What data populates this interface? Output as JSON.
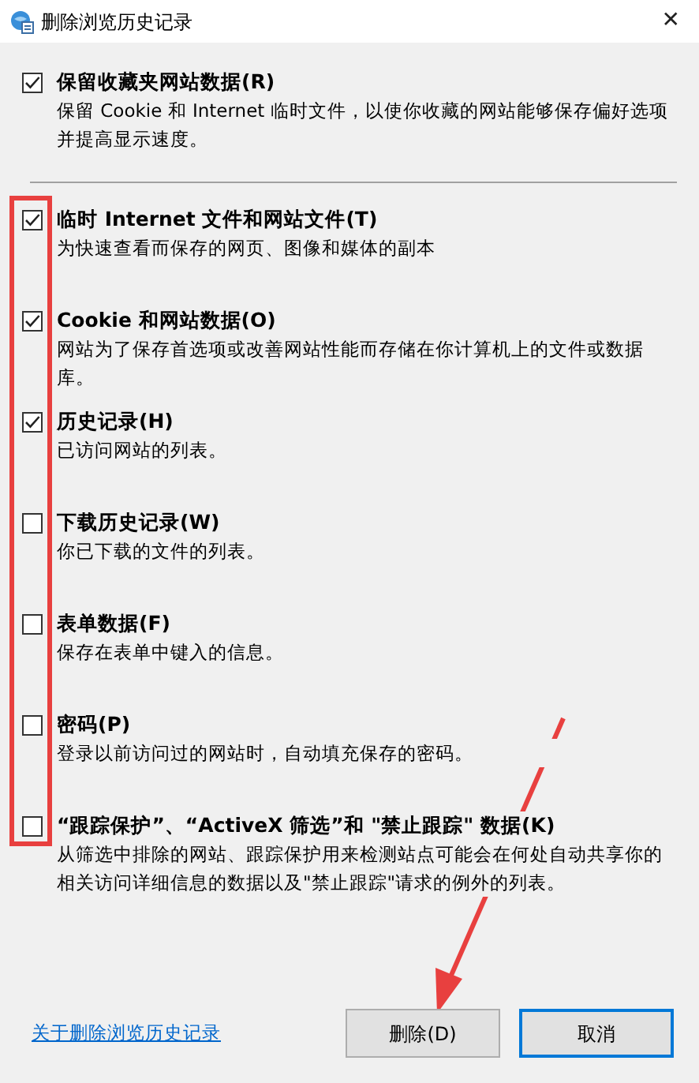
{
  "window": {
    "title": "删除浏览历史记录",
    "close": "✕"
  },
  "keep_option": {
    "label": "保留收藏夹网站数据(R)",
    "description": "保留 Cookie 和 Internet 临时文件，以使你收藏的网站能够保存偏好选项并提高显示速度。",
    "checked": true
  },
  "options": [
    {
      "label": "临时 Internet 文件和网站文件(T)",
      "description": "为快速查看而保存的网页、图像和媒体的副本",
      "checked": true
    },
    {
      "label": "Cookie 和网站数据(O)",
      "description": "网站为了保存首选项或改善网站性能而存储在你计算机上的文件或数据库。",
      "checked": true
    },
    {
      "label": "历史记录(H)",
      "description": "已访问网站的列表。",
      "checked": true
    },
    {
      "label": "下载历史记录(W)",
      "description": "你已下载的文件的列表。",
      "checked": false
    },
    {
      "label": "表单数据(F)",
      "description": "保存在表单中键入的信息。",
      "checked": false
    },
    {
      "label": "密码(P)",
      "description": "登录以前访问过的网站时，自动填充保存的密码。",
      "checked": false
    },
    {
      "label": "“跟踪保护”、“ActiveX 筛选”和 \"禁止跟踪\" 数据(K)",
      "description": "从筛选中排除的网站、跟踪保护用来检测站点可能会在何处自动共享你的相关访问详细信息的数据以及\"禁止跟踪\"请求的例外的列表。",
      "checked": false
    }
  ],
  "help_link": "关于删除浏览历史记录",
  "buttons": [
    {
      "label": "删除(D)",
      "default": false
    },
    {
      "label": "取消",
      "default": true
    }
  ]
}
